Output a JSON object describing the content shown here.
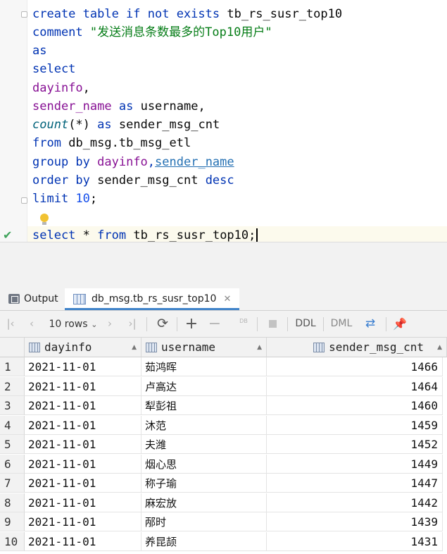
{
  "editor": {
    "lines": [
      [
        "create table if not exists",
        "tb_rs_susr_top10"
      ],
      [
        "comment",
        "\"发送消息条数最多的Top10用户\""
      ],
      [
        "as"
      ],
      [
        "select"
      ],
      [
        "dayinfo",
        ","
      ],
      [
        "sender_name",
        "as",
        "username,"
      ],
      [
        "count",
        "(*)",
        "as",
        "sender_msg_cnt"
      ],
      [
        "from",
        "db_msg.tb_msg_etl"
      ],
      [
        "group by",
        "dayinfo",
        ",",
        "sender_name"
      ],
      [
        "order by",
        "sender_msg_cnt",
        "desc"
      ],
      [
        "limit",
        "10",
        ";"
      ],
      [
        "select",
        "*",
        "from",
        "tb_rs_susr_top10;"
      ]
    ]
  },
  "tabs": {
    "output": "Output",
    "active": "db_msg.tb_rs_susr_top10"
  },
  "toolbar": {
    "rows": "10 rows",
    "ddl": "DDL",
    "dml": "DML",
    "db": "DB"
  },
  "grid": {
    "columns": [
      "dayinfo",
      "username",
      "sender_msg_cnt"
    ],
    "rows": [
      {
        "n": "1",
        "dayinfo": "2021-11-01",
        "username": "茹鸿晖",
        "cnt": "1466"
      },
      {
        "n": "2",
        "dayinfo": "2021-11-01",
        "username": "卢高达",
        "cnt": "1464"
      },
      {
        "n": "3",
        "dayinfo": "2021-11-01",
        "username": "犁彭祖",
        "cnt": "1460"
      },
      {
        "n": "4",
        "dayinfo": "2021-11-01",
        "username": "沐范",
        "cnt": "1459"
      },
      {
        "n": "5",
        "dayinfo": "2021-11-01",
        "username": "夫潍",
        "cnt": "1452"
      },
      {
        "n": "6",
        "dayinfo": "2021-11-01",
        "username": "烟心思",
        "cnt": "1449"
      },
      {
        "n": "7",
        "dayinfo": "2021-11-01",
        "username": "称子瑜",
        "cnt": "1447"
      },
      {
        "n": "8",
        "dayinfo": "2021-11-01",
        "username": "麻宏放",
        "cnt": "1442"
      },
      {
        "n": "9",
        "dayinfo": "2021-11-01",
        "username": "邴时",
        "cnt": "1439"
      },
      {
        "n": "10",
        "dayinfo": "2021-11-01",
        "username": "养昆颉",
        "cnt": "1431"
      }
    ]
  }
}
